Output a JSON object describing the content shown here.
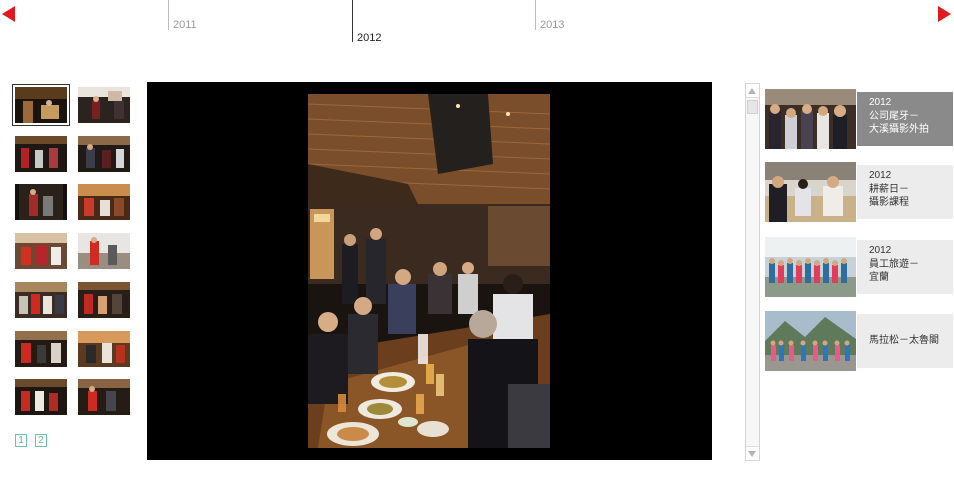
{
  "timeline": {
    "prev_icon": "arrow-left-icon",
    "next_icon": "arrow-right-icon",
    "accent": "#e0191f",
    "years": [
      {
        "label": "2011",
        "active": false
      },
      {
        "label": "2012",
        "active": true
      },
      {
        "label": "2013",
        "active": false
      }
    ]
  },
  "gallery": {
    "selected_index": 0,
    "pages": [
      "1",
      "2"
    ],
    "page_color": "#5ab596"
  },
  "albums": [
    {
      "year": "2012",
      "line1": "公司尾牙－",
      "line2": "大溪攝影外拍",
      "active": true
    },
    {
      "year": "2012",
      "line1": "耕薪日－",
      "line2": "攝影課程",
      "active": false
    },
    {
      "year": "2012",
      "line1": "員工旅遊－",
      "line2": "宜蘭",
      "active": false
    },
    {
      "year": "",
      "line1": "馬拉松－太魯閣",
      "line2": "",
      "active": false
    }
  ]
}
